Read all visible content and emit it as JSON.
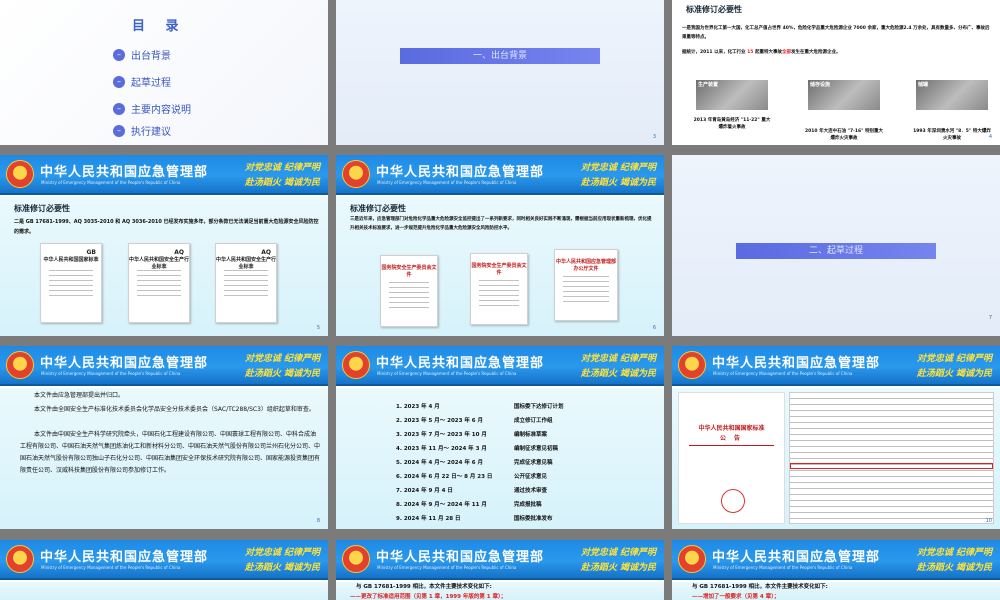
{
  "header": {
    "title": "中华人民共和国应急管理部",
    "subtitle": "Ministry of Emergency Management of the People's Republic of China",
    "motto_line1": "对党忠诚 纪律严明",
    "motto_line2": "赴汤蹈火 竭诚为民"
  },
  "toc": {
    "title": "目 录",
    "items": [
      "出台背景",
      "起草过程",
      "主要内容说明",
      "执行建议"
    ]
  },
  "section1": {
    "label": "一、出台背景",
    "page": "3"
  },
  "section2": {
    "label": "二、起草过程",
    "page": "7"
  },
  "background1": {
    "title": "标准修订必要性",
    "bullet1": "一是我国为世界化工第一大国，化工总产值占世界 40%，危险化学品重大危险源企业 7000 余家，重大危险源2.4 万余处，具有数量多、分布广、事故后果重等特点。",
    "bullet2_pre": "据统计，2011 以来，化工行业 ",
    "bullet2_num": "15",
    "bullet2_mid": " 起重特大事故",
    "bullet2_all": "全部",
    "bullet2_post": "发生在重大危险源企业。",
    "photos": [
      {
        "tag": "生产装置",
        "caption": "2013 年青岛黄岛经济 \"11·22\" 重大爆炸着火事故"
      },
      {
        "tag": "储存设施",
        "caption": "2010 年大连中石油 \"7·16\" 特别重大爆炸火灾事故"
      },
      {
        "tag": "储罐",
        "caption": "1993 年深圳清水河 \"8．5\" 特大爆炸火灾事故"
      }
    ],
    "page": "4"
  },
  "background2": {
    "title": "标准修订必要性",
    "text": "二是 GB 17681-1999、AQ 3035-2010 和 AQ 3036-2010 已经发布实施多年，部分条款已无法满足当前重大危险源安全风险防控的需求。",
    "docs": [
      {
        "code": "GB",
        "head": "中华人民共和国国家标准"
      },
      {
        "code": "AQ",
        "head": "中华人民共和国安全生产行业标准"
      },
      {
        "code": "AQ",
        "head": "中华人民共和国安全生产行业标准"
      }
    ],
    "page": "5"
  },
  "background3": {
    "title": "标准修订必要性",
    "text": "三是近年来，应急管理部门对危险化学品重大危险源安全监控提出了一系列新要求，同时相关良好实践不断涌现，需根据当前应用现状重新梳理，优化提升相关技术标准要求，进一步规范提升危险化学品重大危险源安全风险防控水平。",
    "docs": [
      {
        "head": "国务院安全生产委员会文件"
      },
      {
        "head": "国务院安全生产委员会文件"
      },
      {
        "head": "中华人民共和国应急管理部办公厅文件"
      }
    ],
    "page": "6"
  },
  "drafting": {
    "p1": "本文件由应急管理部提出并归口。",
    "p2": "本文件由全国安全生产标准化技术委员会化学品安全分技术委员会（SAC/TC288/SC3）组织起草和审查。",
    "p3": "本文件由中国安全生产科学研究院牵头，中国石化工程建设有限公司、中国寰球工程有限公司、中科合成油工程有限公司、中国石油天然气集团炼油化工和新材料分公司、中国石油天然气股份有限公司兰州石化分公司、中国石油天然气股份有限公司独山子石化分公司、中国石油集团安全环保技术研究院有限公司、国家能源投资集团有限责任公司、汉威科技集团股份有限公司参加修订工作。",
    "page": "8"
  },
  "timeline": [
    {
      "n": "1.",
      "date": "2023 年 4 月",
      "event": "国标委下达修订计划"
    },
    {
      "n": "2.",
      "date": "2023 年 5 月～ 2023 年 6 月",
      "event": "成立修订工作组"
    },
    {
      "n": "3.",
      "date": "2023 年 7 月～ 2023 年 10 月",
      "event": "编制标准草案"
    },
    {
      "n": "4.",
      "date": "2023 年 11 月～ 2024 年 3 月",
      "event": "编制征求意见初稿"
    },
    {
      "n": "5.",
      "date": "2024 年 4 月～ 2024 年 6 月",
      "event": "完成征求意见稿"
    },
    {
      "n": "6.",
      "date": "2024 年 6 月 22 日～ 8 月 23 日",
      "event": "公开征求意见"
    },
    {
      "n": "7.",
      "date": "2024 年 9 月 4 日",
      "event": "通过技术审查"
    },
    {
      "n": "8.",
      "date": "2024 年 9 月～ 2024 年 11 月",
      "event": "完成报批稿"
    },
    {
      "n": "9.",
      "date": "2024 年 11 月 28 日",
      "event": "国标委批准发布"
    }
  ],
  "announcement": {
    "line1": "中华人民共和国国家标准",
    "line2": "公 告",
    "page": "10"
  },
  "changes1": {
    "intro": "与 GB 17681-1999 相比，本文件主要技术变化如下:",
    "first": "——更改了标准适用范围（见第 1 章，1999 年版的第 1 章）；"
  },
  "changes2": {
    "intro": "与 GB 17681-1999 相比，本文件主要技术变化如下:",
    "first": "——增加了一般要求（见第 4 章）；"
  }
}
